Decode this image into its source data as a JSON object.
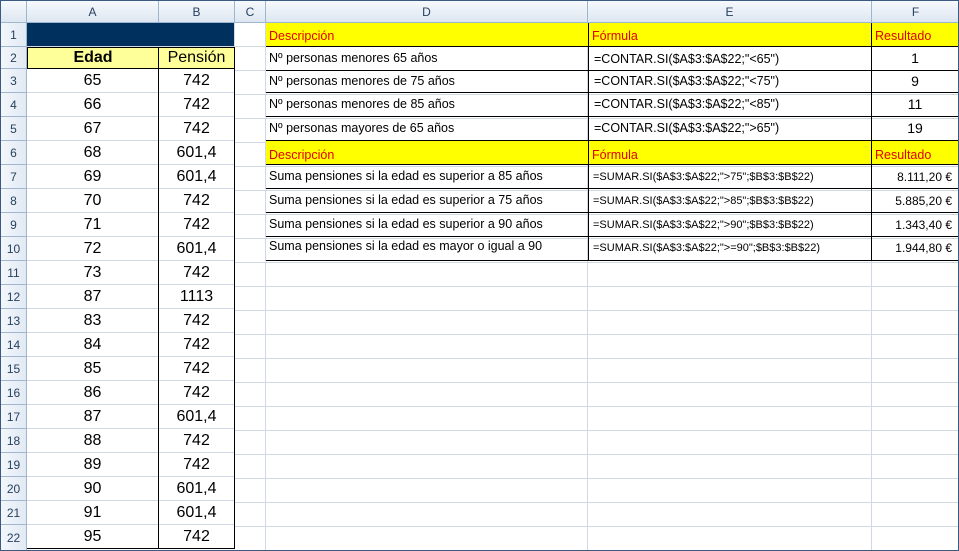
{
  "columns": [
    "A",
    "B",
    "C",
    "D",
    "E",
    "F"
  ],
  "rows": [
    "1",
    "2",
    "3",
    "4",
    "5",
    "6",
    "7",
    "8",
    "9",
    "10",
    "11",
    "12",
    "13",
    "14",
    "15",
    "16",
    "17",
    "18",
    "19",
    "20",
    "21",
    "22"
  ],
  "left_table": {
    "header": {
      "edad": "Edad",
      "pension": "Pensión"
    },
    "rows": [
      {
        "edad": "65",
        "pension": "742"
      },
      {
        "edad": "66",
        "pension": "742"
      },
      {
        "edad": "67",
        "pension": "742"
      },
      {
        "edad": "68",
        "pension": "601,4"
      },
      {
        "edad": "69",
        "pension": "601,4"
      },
      {
        "edad": "70",
        "pension": "742"
      },
      {
        "edad": "71",
        "pension": "742"
      },
      {
        "edad": "72",
        "pension": "601,4"
      },
      {
        "edad": "73",
        "pension": "742"
      },
      {
        "edad": "87",
        "pension": "1113"
      },
      {
        "edad": "83",
        "pension": "742"
      },
      {
        "edad": "84",
        "pension": "742"
      },
      {
        "edad": "85",
        "pension": "742"
      },
      {
        "edad": "86",
        "pension": "742"
      },
      {
        "edad": "87",
        "pension": "601,4"
      },
      {
        "edad": "88",
        "pension": "742"
      },
      {
        "edad": "89",
        "pension": "742"
      },
      {
        "edad": "90",
        "pension": "601,4"
      },
      {
        "edad": "91",
        "pension": "601,4"
      },
      {
        "edad": "95",
        "pension": "742"
      }
    ]
  },
  "table1": {
    "headers": {
      "descripcion": "Descripción",
      "formula": "Fórmula",
      "resultado": "Resultado"
    },
    "rows": [
      {
        "desc": "Nº personas  menores 65 años",
        "formula": "=CONTAR.SI($A$3:$A$22;\"<65\")",
        "result": "1"
      },
      {
        "desc": "Nº personas menores de  75 años",
        "formula": "=CONTAR.SI($A$3:$A$22;\"<75\")",
        "result": "9"
      },
      {
        "desc": "Nº personas menores de  85 años",
        "formula": "=CONTAR.SI($A$3:$A$22;\"<85\")",
        "result": "11"
      },
      {
        "desc": "Nº personas mayores de 65 años",
        "formula": "=CONTAR.SI($A$3:$A$22;\">65\")",
        "result": "19"
      }
    ]
  },
  "table2": {
    "headers": {
      "descripcion": "Descripción",
      "formula": "Fórmula",
      "resultado": "Resultado"
    },
    "rows": [
      {
        "desc": "Suma pensiones si la edad es superior a 85 años",
        "formula": "=SUMAR.SI($A$3:$A$22;\">75\";$B$3:$B$22)",
        "result": "8.111,20 €"
      },
      {
        "desc": "Suma pensiones si la edad es superior a 75 años",
        "formula": "=SUMAR.SI($A$3:$A$22;\">85\";$B$3:$B$22)",
        "result": "5.885,20 €"
      },
      {
        "desc": "Suma pensiones si la edad es superior a 90 años",
        "formula": "=SUMAR.SI($A$3:$A$22;\">90\";$B$3:$B$22)",
        "result": "1.343,40 €"
      },
      {
        "desc": "Suma pensiones si la edad es mayor o igual a 90",
        "formula": "=SUMAR.SI($A$3:$A$22;\">=90\";$B$3:$B$22)",
        "result": "1.944,80 €"
      }
    ]
  }
}
